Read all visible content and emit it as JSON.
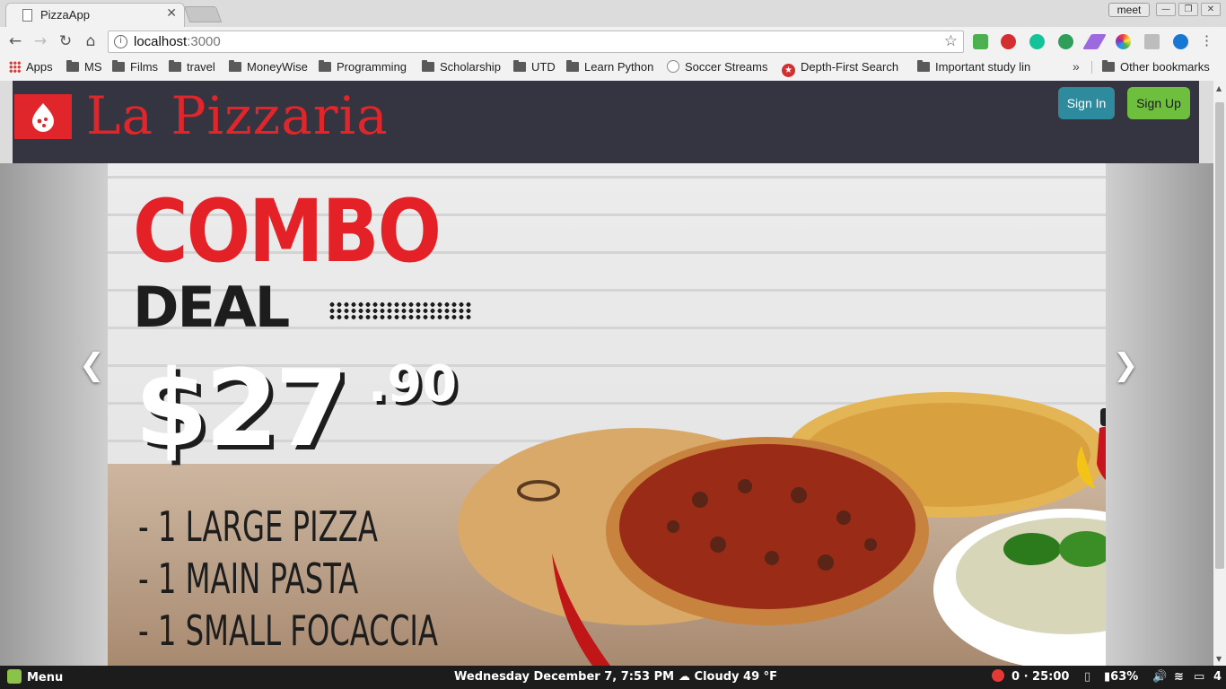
{
  "browser": {
    "tab_title": "PizzaApp",
    "profile": "meet",
    "url_host": "localhost",
    "url_port": ":3000",
    "bookmarks": [
      "Apps",
      "MS",
      "Films",
      "travel",
      "MoneyWise",
      "Programming",
      "Scholarship",
      "UTD",
      "Learn Python",
      "Soccer Streams",
      "Depth-First Search",
      "Important study lin"
    ],
    "other_bookmarks": "Other bookmarks"
  },
  "header": {
    "brand": "La Pizzaria",
    "signin_label": "Sign In",
    "signup_label": "Sign Up"
  },
  "slide": {
    "headline": "COMBO",
    "subheadline": "DEAL",
    "price_main": "$27",
    "price_cents": ".90",
    "items": [
      "- 1 LARGE PIZZA",
      "- 1 MAIN PASTA",
      "- 1 SMALL FOCACCIA"
    ],
    "prev_icon": "chevron-left-icon",
    "next_icon": "chevron-right-icon"
  },
  "taskbar": {
    "menu": "Menu",
    "datetime": "Wednesday December  7,  7:53 PM",
    "weather": "Cloudy 49 °F",
    "timer": "0 · 25:00",
    "battery": "63%",
    "workspace": "4"
  },
  "colors": {
    "brand_red": "#e0262b",
    "header_bg": "#343541",
    "signin": "#2e8b9e",
    "signup": "#6fbf3f"
  }
}
